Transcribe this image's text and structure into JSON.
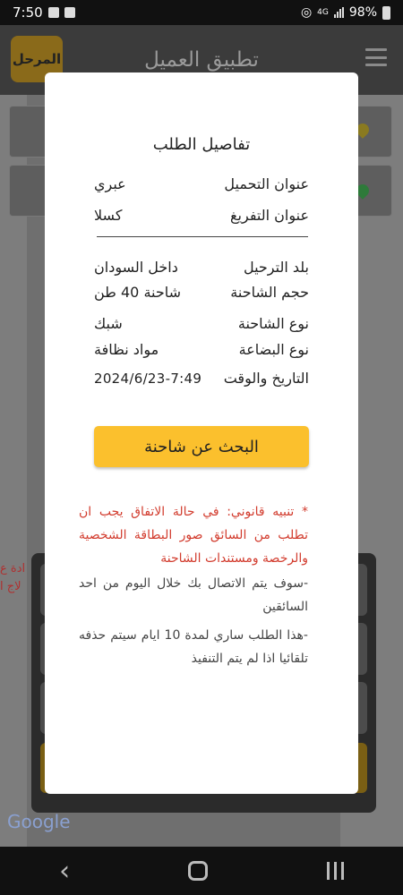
{
  "status_bar": {
    "time": "7:50",
    "battery": "98%",
    "network": "4G"
  },
  "app_bar": {
    "title": "تطبيق العميل",
    "stage_button": "المرحل"
  },
  "map": {
    "side_text_1": "ادة ع",
    "side_text_2": "لاج ا",
    "google": "Google"
  },
  "dialog": {
    "title": "تفاصيل الطلب",
    "rows": [
      {
        "label": "عنوان التحميل",
        "value": "عبري"
      },
      {
        "label": "عنوان التفريغ",
        "value": "كسلا"
      },
      {
        "label": "بلد الترحيل",
        "value": "داخل السودان"
      },
      {
        "label": "حجم الشاحنة",
        "value": "شاحنة 40 طن"
      },
      {
        "label": "نوع الشاحنة",
        "value": "شبك"
      },
      {
        "label": "نوع البضاعة",
        "value": "مواد نظافة"
      },
      {
        "label": "التاريخ والوقت",
        "value": "2024/6/23-7:49"
      }
    ],
    "search_button": "البحث عن شاحنة",
    "legal_notice": "* تنبيه قانوني: في حالة الاتفاق يجب ان تطلب من السائق صور البطاقة الشخصية والرخصة ومستندات الشاحنة",
    "contact_note": "-سوف يتم الاتصال بك خلال اليوم من احد السائقين",
    "validity_note": "-هذا الطلب ساري لمدة 10 ايام سيتم حذفه تلقائيا اذا لم يتم التنفيذ"
  },
  "colors": {
    "accent": "#fbc02d",
    "warning_text": "#d23c2e",
    "dialog_bg": "#ffffff"
  }
}
